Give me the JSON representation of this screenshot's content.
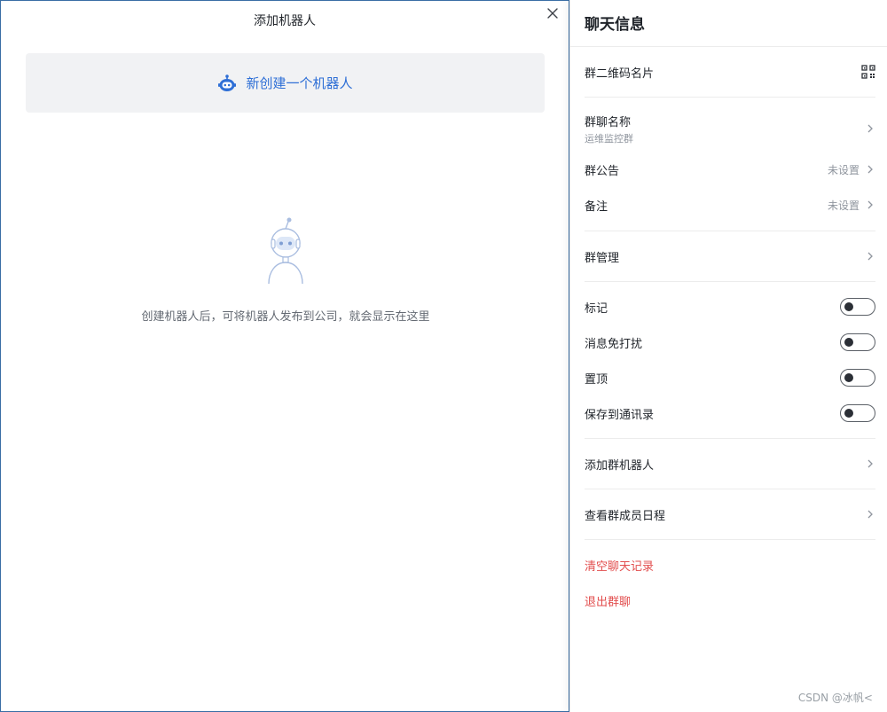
{
  "dialog": {
    "title": "添加机器人",
    "create_label": "新创建一个机器人",
    "empty_text": "创建机器人后，可将机器人发布到公司，就会显示在这里",
    "accent": "#2e6fd6"
  },
  "panel": {
    "title": "聊天信息",
    "qr_label": "群二维码名片",
    "group_name_label": "群聊名称",
    "group_name_value": "运维监控群",
    "notice_label": "群公告",
    "notice_value": "未设置",
    "remark_label": "备注",
    "remark_value": "未设置",
    "manage_label": "群管理",
    "toggles": [
      {
        "label": "标记",
        "on": false
      },
      {
        "label": "消息免打扰",
        "on": false
      },
      {
        "label": "置顶",
        "on": false
      },
      {
        "label": "保存到通讯录",
        "on": false
      }
    ],
    "add_bot_label": "添加群机器人",
    "schedule_label": "查看群成员日程",
    "clear_label": "清空聊天记录",
    "exit_label": "退出群聊",
    "danger_color": "#e24d4d"
  },
  "watermark": "CSDN @冰帆<"
}
